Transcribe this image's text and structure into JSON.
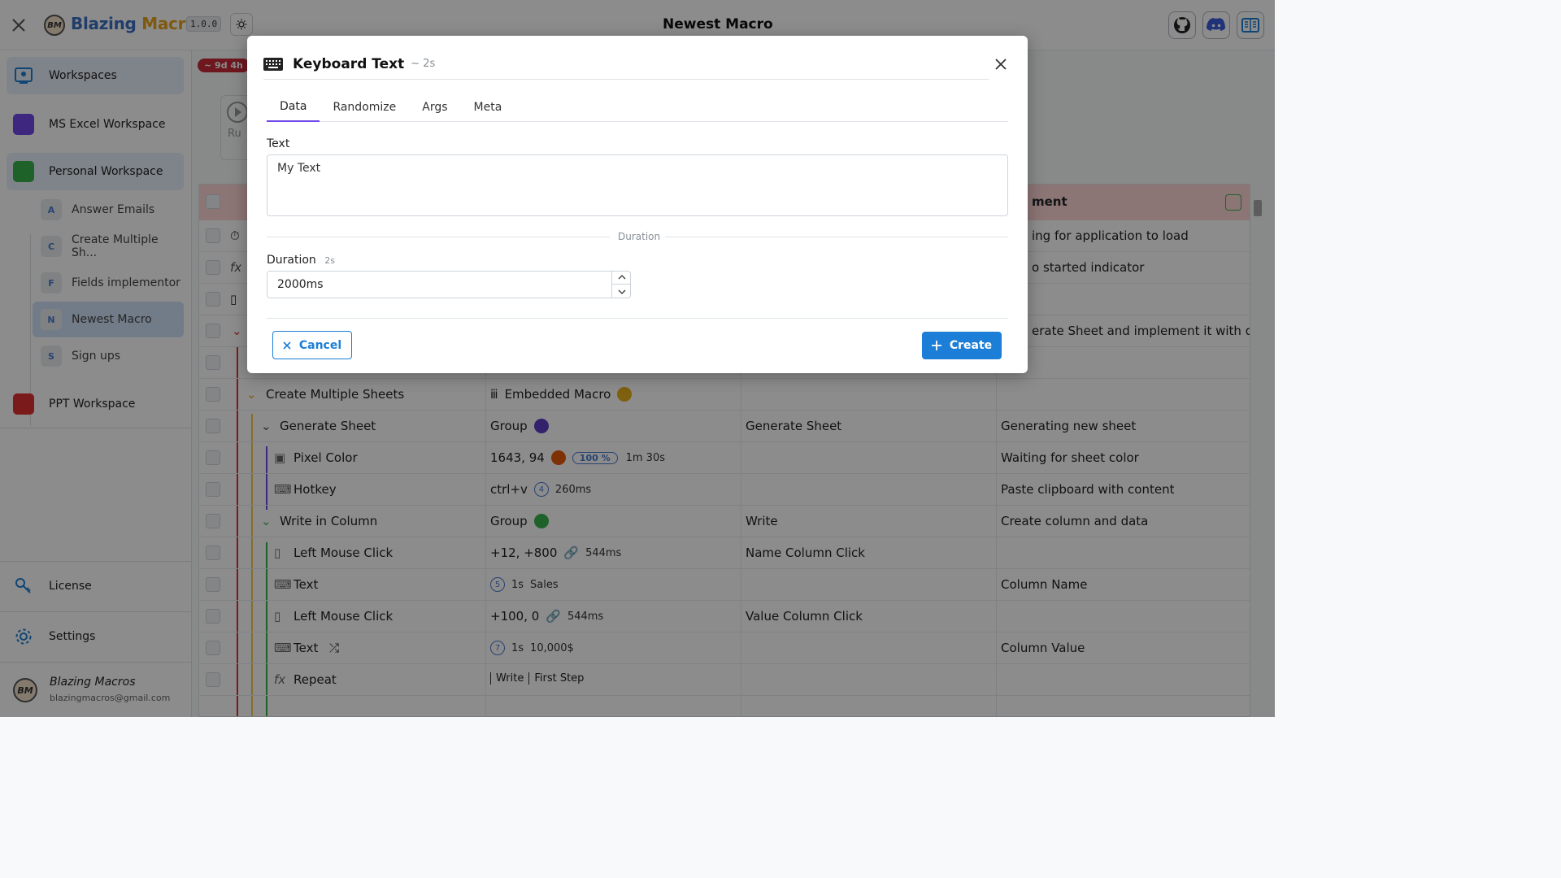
{
  "app": {
    "name_part1": "Blazing ",
    "name_part2": "Macros",
    "version": "1.0.0",
    "logo_text": "BM",
    "page_title": "Newest Macro"
  },
  "sidebar": {
    "workspaces_label": "Workspaces",
    "items": [
      {
        "label": "MS Excel Workspace",
        "color": "#7048e8"
      },
      {
        "label": "Personal Workspace",
        "color": "#37b24d"
      },
      {
        "label": "PPT Workspace",
        "color": "#e03131"
      }
    ],
    "macros": [
      {
        "letter": "A",
        "label": "Answer Emails"
      },
      {
        "letter": "C",
        "label": "Create Multiple Sh..."
      },
      {
        "letter": "F",
        "label": "Fields implementor"
      },
      {
        "letter": "N",
        "label": "Newest Macro"
      },
      {
        "letter": "S",
        "label": "Sign ups"
      }
    ],
    "license_label": "License",
    "settings_label": "Settings",
    "user_name": "Blazing Macros",
    "user_email": "blazingmacros@gmail.com"
  },
  "main": {
    "time_badge": "~ 9d 4h",
    "run_label": "Ru",
    "header_comment": "ment",
    "rows": [
      {
        "name": "",
        "value": "",
        "label": "",
        "comment": "ing for application to load"
      },
      {
        "name": "",
        "value": "",
        "label": "",
        "comment": "o started indicator"
      },
      {
        "name": "",
        "value": "",
        "label": "",
        "comment": ""
      },
      {
        "name": "",
        "value": "",
        "label": "",
        "comment": "erate Sheet and implement it with data"
      },
      {
        "name": "",
        "value": "",
        "label": "",
        "comment": ""
      },
      {
        "name": "Create Multiple Sheets",
        "value": "Embedded Macro",
        "label": "",
        "comment": ""
      },
      {
        "name": "Generate Sheet",
        "value": "Group",
        "label": "Generate Sheet",
        "comment": "Generating new sheet"
      },
      {
        "name": "Pixel Color",
        "value": "1643, 94",
        "pct": "100 %",
        "extra": "1m 30s",
        "label": "",
        "comment": "Waiting for sheet color"
      },
      {
        "name": "Hotkey",
        "value": "ctrl+v",
        "num": "4",
        "extra": "260ms",
        "label": "",
        "comment": "Paste clipboard with content"
      },
      {
        "name": "Write in Column",
        "value": "Group",
        "label": "Write",
        "comment": "Create column and data"
      },
      {
        "name": "Left Mouse Click",
        "value": "+12, +800",
        "extra": "544ms",
        "label": "Name Column Click",
        "comment": ""
      },
      {
        "name": "Text",
        "num": "5",
        "value": "1s",
        "extra": "Sales",
        "label": "",
        "comment": "Column Name"
      },
      {
        "name": "Left Mouse Click",
        "value": "+100, 0",
        "extra": "544ms",
        "label": "Value Column Click",
        "comment": ""
      },
      {
        "name": "Text",
        "num": "7",
        "value": "1s",
        "extra": "10,000$",
        "label": "",
        "comment": "Column Value"
      },
      {
        "name": "Repeat",
        "value": "Write",
        "extra": "First Step",
        "label": "",
        "comment": ""
      }
    ]
  },
  "modal": {
    "title": "Keyboard Text",
    "subtitle": "~ 2s",
    "tabs": [
      "Data",
      "Randomize",
      "Args",
      "Meta"
    ],
    "text_label": "Text",
    "text_value": "My Text",
    "section_label": "Duration",
    "duration_label": "Duration",
    "duration_hint": "2s",
    "duration_value": "2000ms",
    "cancel_label": "Cancel",
    "create_label": "Create"
  }
}
